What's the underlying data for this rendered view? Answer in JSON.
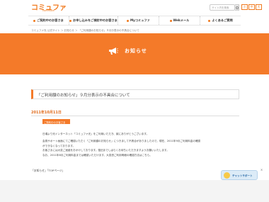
{
  "header": {
    "logo": "コミュファ",
    "logo_sub": "commufa",
    "search_placeholder": "サイト内を検索",
    "font_sizes": [
      "小",
      "中",
      "大"
    ]
  },
  "nav": [
    {
      "label": "ご契約中のお客さま"
    },
    {
      "label": "お申し込みをご検討中のお客さま"
    },
    {
      "label": "Myコミュファ"
    },
    {
      "label": "Webメール"
    },
    {
      "label": "よくあるご質問"
    }
  ],
  "breadcrumb": "コミュファ光 公式サイト ＞ お知らせ ＞ 「ご利用額のお知らせ」９月分表示の不具合について",
  "banner": {
    "title": "お知らせ",
    "icon": "megaphone-icon"
  },
  "article": {
    "title": "「ご利用額のお知らせ」９月分表示の不具合について",
    "date": "2011年10月11日",
    "badge": "ご契約中のお客さま",
    "paragraphs": [
      "日頃より光インターネット「コミュファ光」をご利用いただき、誠にありがとうございます。",
      "会員サポート画面にてご確認いただく「ご利用額のお知らせ」につきまして不具合がありましたので、現在、2011年9月ご利用料金の確認",
      "ができなくなっております。",
      "お客さまには大変ご迷惑をおかけしております。復旧までしばらくお待ちいただきますようお願いいたします。",
      "なお、2011年8月ご利用料金までは確認いただけます。大変恐ご利用明細の確認方法はこちら。"
    ]
  },
  "footer_links": "「お知らせ」「TOPページ」",
  "chat": {
    "label": "チャットサポート",
    "close": "×"
  },
  "colors": {
    "brand_orange": "#f47a29",
    "date_orange": "#e06a1a"
  }
}
